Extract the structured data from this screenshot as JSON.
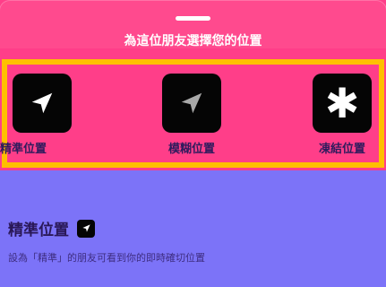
{
  "sheet": {
    "title": "為這位朋友選擇您的位置"
  },
  "options": [
    {
      "label": "精準位置",
      "icon": "navigation-arrow-icon"
    },
    {
      "label": "模糊位置",
      "icon": "navigation-arrow-faded-icon"
    },
    {
      "label": "凍結位置",
      "icon": "asterisk-icon"
    }
  ],
  "detail": {
    "heading": "精準位置",
    "heading_icon": "navigation-arrow-icon",
    "description": "設為「精準」的朋友可看到你的即時確切位置"
  },
  "colors": {
    "sheet_background": "#ff3e89",
    "body_background": "#7c73f8",
    "selection_highlight": "#ffbf00",
    "tile_background": "#050505"
  }
}
